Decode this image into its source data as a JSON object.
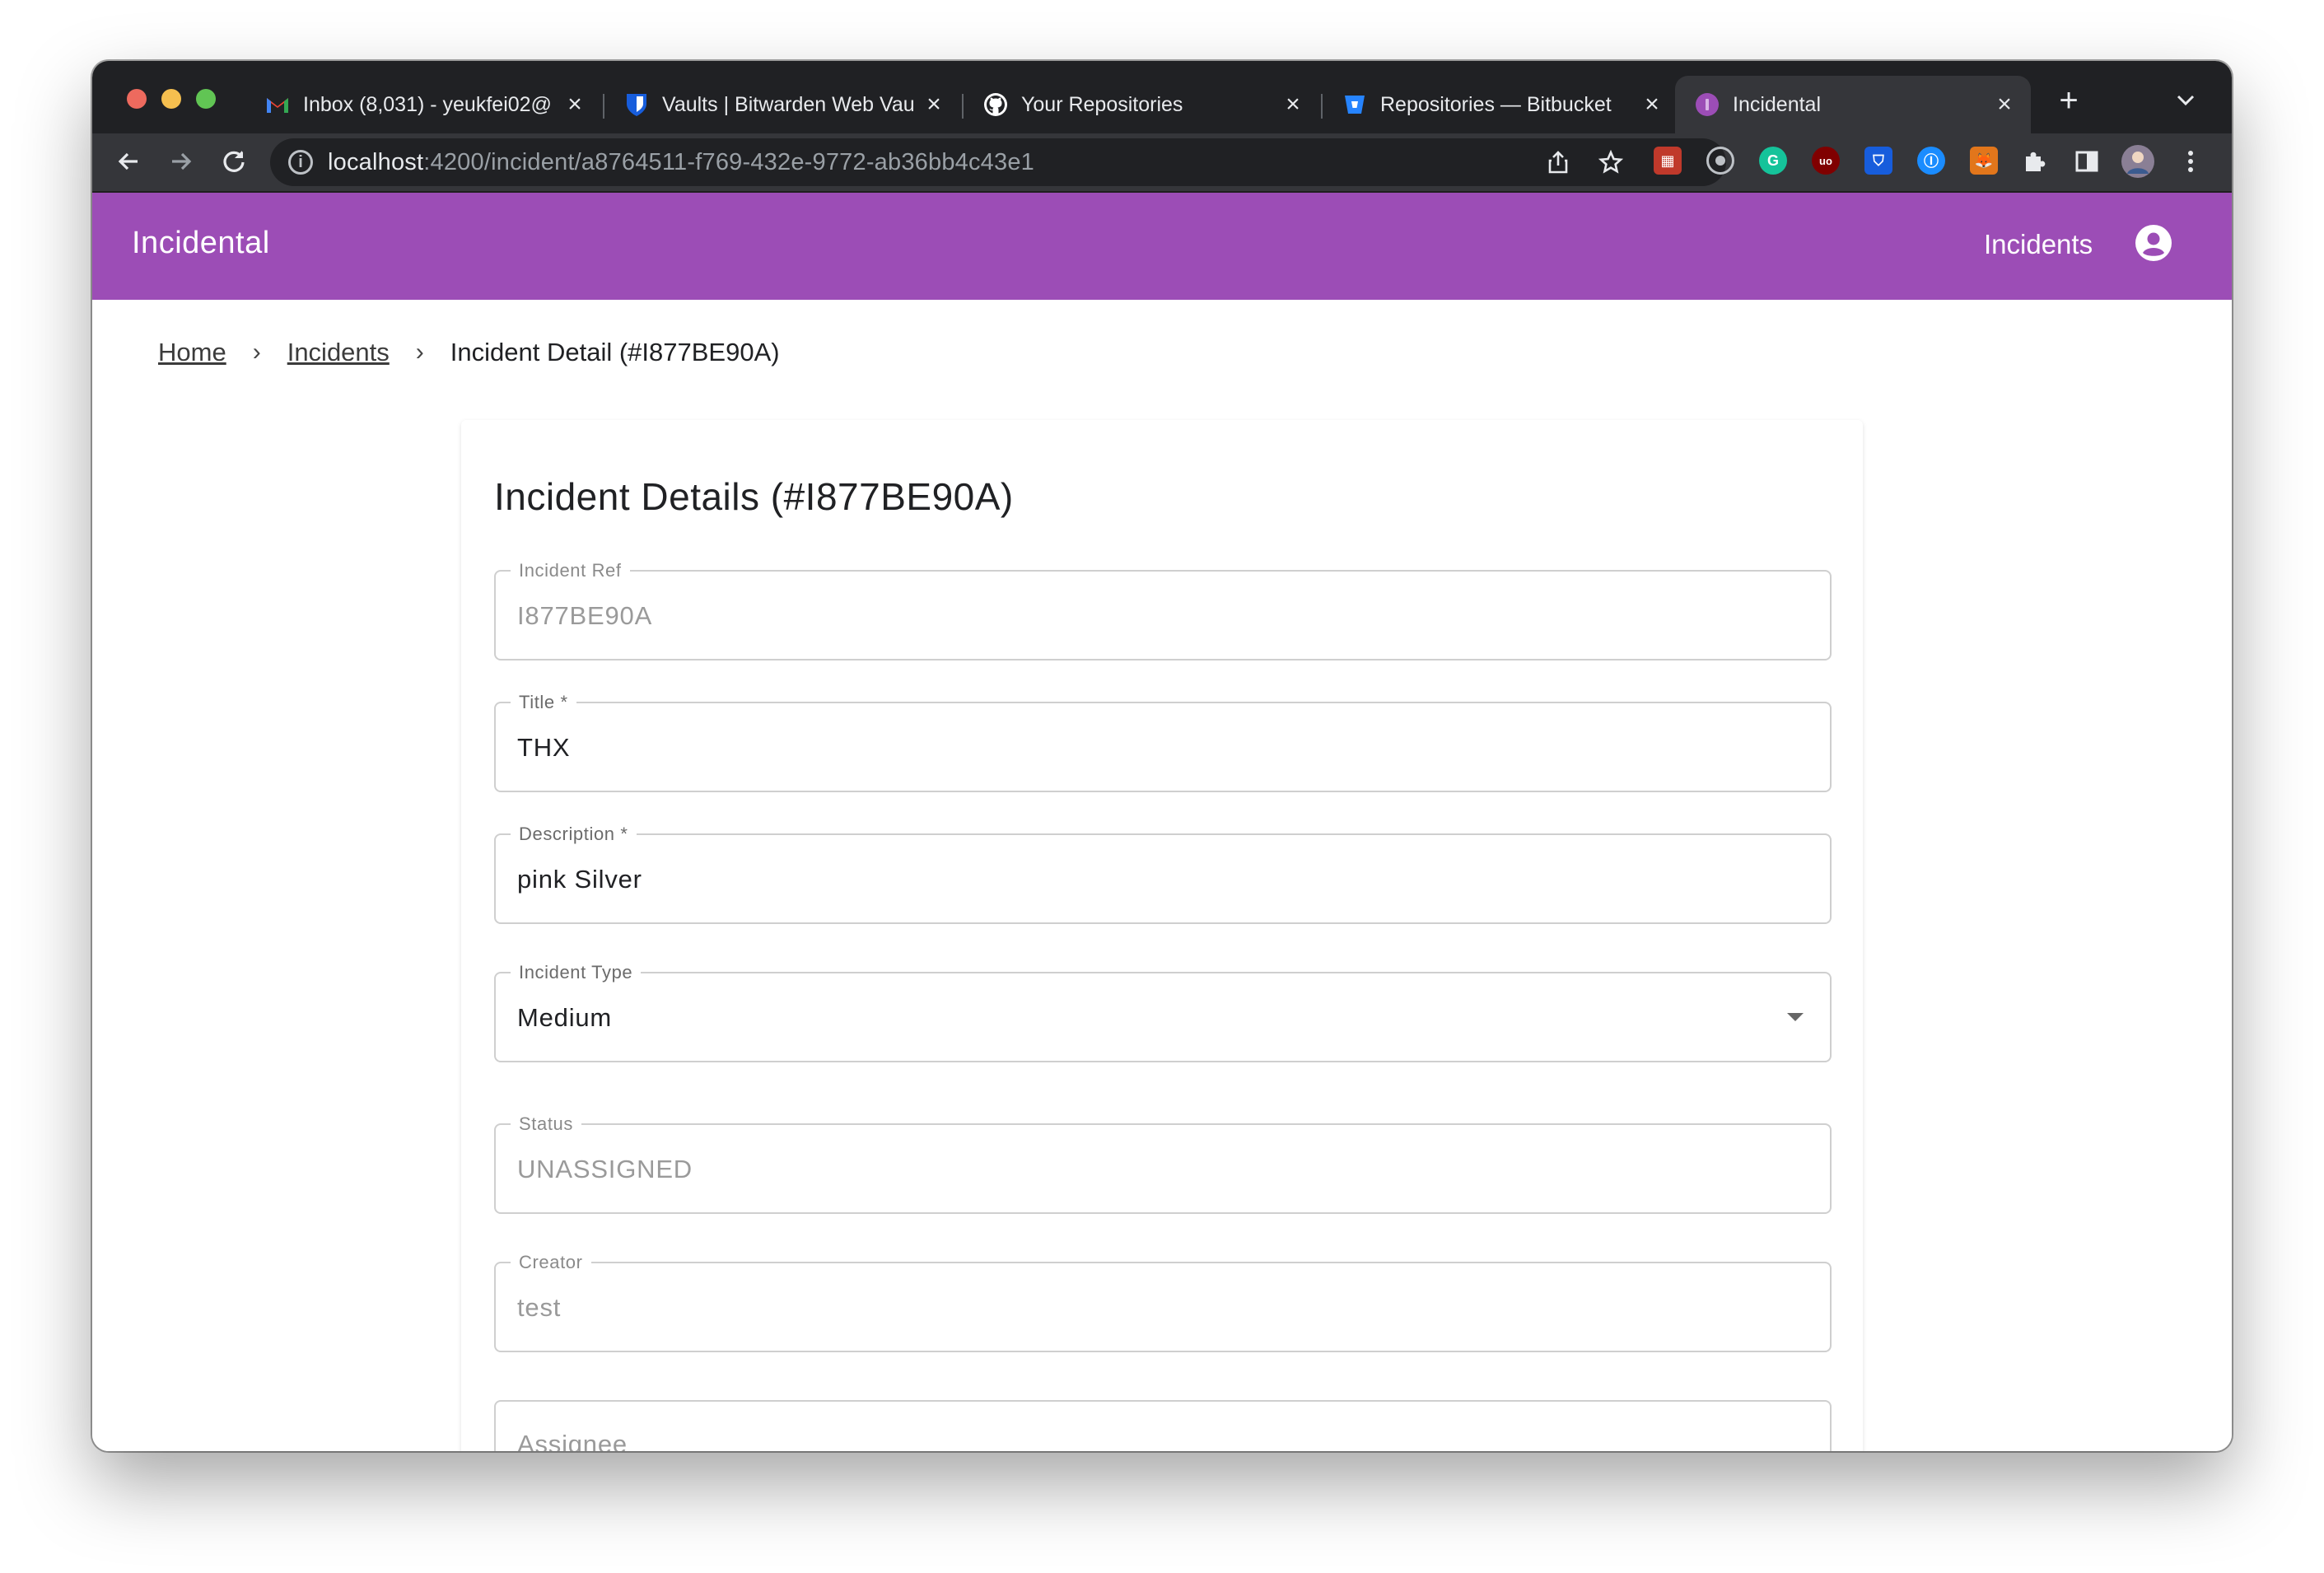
{
  "browser": {
    "tabs": [
      {
        "label": "Inbox (8,031) - yeukfei02@",
        "icon": "gmail-icon"
      },
      {
        "label": "Vaults | Bitwarden Web Vau",
        "icon": "bitwarden-icon"
      },
      {
        "label": "Your Repositories",
        "icon": "github-icon"
      },
      {
        "label": "Repositories — Bitbucket",
        "icon": "bitbucket-icon"
      },
      {
        "label": "Incidental",
        "icon": "incidental-icon"
      }
    ],
    "new_tab": "+",
    "url_host": "localhost",
    "url_rest": ":4200/incident/a8764511-f769-432e-9772-ab36bb4c43e1"
  },
  "app": {
    "title": "Incidental",
    "nav_incidents": "Incidents",
    "brand_color": "#9c4db6"
  },
  "breadcrumb": {
    "home": "Home",
    "incidents": "Incidents",
    "current": "Incident Detail (#I877BE90A)"
  },
  "card": {
    "title": "Incident Details (#I877BE90A)",
    "fields": {
      "ref": {
        "label": "Incident Ref",
        "value": "I877BE90A"
      },
      "title": {
        "label": "Title *",
        "value": "THX"
      },
      "description": {
        "label": "Description *",
        "value": "pink Silver"
      },
      "type": {
        "label": "Incident Type",
        "value": "Medium"
      },
      "status": {
        "label": "Status",
        "value": "UNASSIGNED"
      },
      "creator": {
        "label": "Creator",
        "value": "test"
      },
      "assignee": {
        "label": "",
        "value": "Assignee"
      }
    }
  }
}
